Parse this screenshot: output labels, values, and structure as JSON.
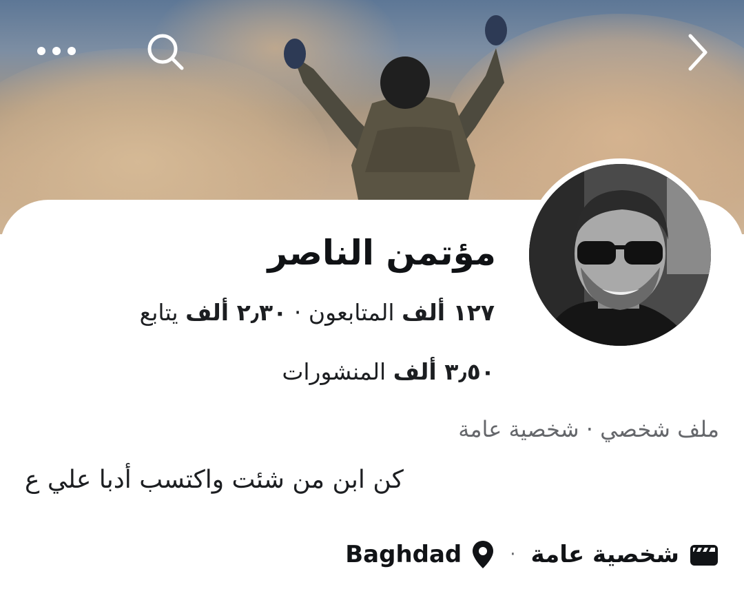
{
  "header": {
    "more_icon": "more-horizontal-icon",
    "search_icon": "search-icon",
    "forward_icon": "chevron-right-icon"
  },
  "profile": {
    "name": "مؤتمن الناصر",
    "followers_count": "١٢٧ ألف",
    "followers_label": "المتابعون",
    "following_count": "٢٫٣٠ ألف",
    "following_label": "يتابع",
    "posts_count": "٣٫٥٠ ألف",
    "posts_label": "المنشورات",
    "stat_separator": "·",
    "category_line": "ملف شخصي · شخصية عامة",
    "bio": "كن ابن من شئت واكتسب أدبا  علي ع"
  },
  "details": {
    "page_type_label": "شخصية عامة",
    "page_type_icon": "clapperboard-icon",
    "location_label": "Baghdad",
    "location_icon": "location-pin-icon",
    "separator": "·"
  },
  "colors": {
    "primary_text": "#1c1e21",
    "secondary_text": "#65676b",
    "background": "#ffffff"
  }
}
